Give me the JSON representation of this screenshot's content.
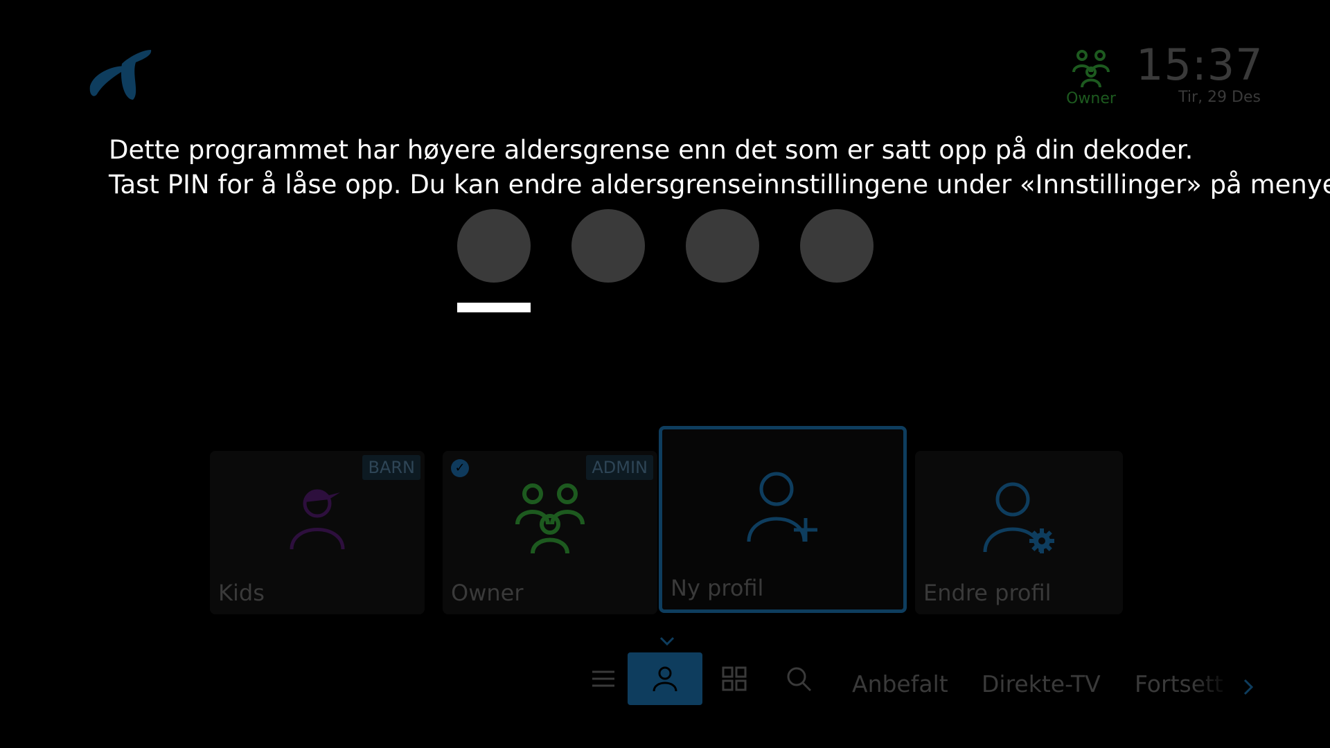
{
  "header": {
    "logo": "telenor-logo",
    "active_profile": {
      "icon": "group-profile-icon",
      "name": "Owner",
      "color": "#1d5a1f"
    },
    "clock": {
      "time": "15:37",
      "date": "Tir, 29 Des"
    }
  },
  "message": {
    "line1": "Dette programmet har høyere aldersgrense enn det som er satt opp på din dekoder.",
    "line2": "Tast PIN for å låse opp. Du kan endre aldersgrenseinnstillingene under «Innstillinger» på menyen"
  },
  "pin": {
    "digits_entered": 0,
    "digit_count": 4,
    "active_index": 0
  },
  "profiles": [
    {
      "label": "Kids",
      "badge": "BARN",
      "icon": "kid-profile-icon",
      "selected": false,
      "color": "#2d0f3d"
    },
    {
      "label": "Owner",
      "badge": "ADMIN",
      "icon": "group-profile-icon",
      "selected": true,
      "color": "#1d5a1f"
    },
    {
      "label": "Ny profil",
      "icon": "add-profile-icon",
      "focused": true,
      "color": "#0e3d5e"
    },
    {
      "label": "Endre profil",
      "icon": "edit-profile-icon",
      "color": "#0e3d5e"
    }
  ],
  "nav": {
    "items": [
      {
        "icon": "menu-icon"
      },
      {
        "icon": "profile-icon",
        "active": true
      },
      {
        "icon": "grid-icon"
      },
      {
        "icon": "search-icon"
      }
    ],
    "links": [
      "Anbefalt",
      "Direkte-TV",
      "Fortsett å"
    ],
    "accent": "#0e3d5e"
  }
}
